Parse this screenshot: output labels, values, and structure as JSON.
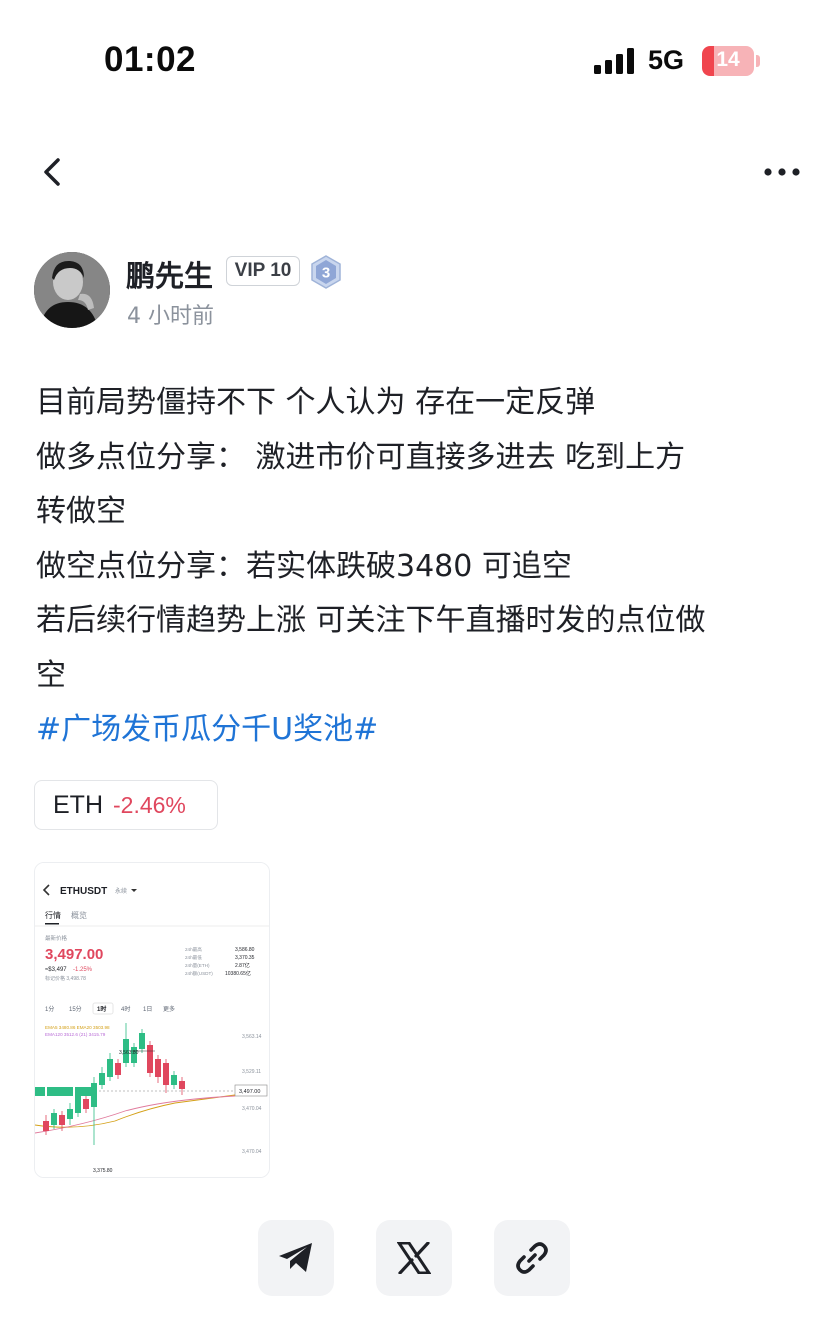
{
  "status_bar": {
    "time": "01:02",
    "network": "5G",
    "battery_level": "14",
    "battery_fraction": 0.14
  },
  "nav": {
    "back_icon": "chevron-left-icon",
    "more_icon": "ellipsis-icon"
  },
  "author": {
    "name": "鹏先生",
    "vip": "VIP 10",
    "level": "3",
    "time_ago": "4 小时前"
  },
  "post": {
    "lines": [
      "目前局势僵持不下 个人认为 存在一定反弹",
      "做多点位分享： 激进市价可直接多进去 吃到上方",
      "转做空",
      "做空点位分享：若实体跌破3480 可追空",
      "若后续行情趋势上涨 可关注下午直播时发的点位做",
      "空"
    ],
    "hashtag": "#广场发币瓜分千U奖池#"
  },
  "ticker": {
    "symbol": "ETH",
    "change": "-2.46%",
    "change_color": "#e0475e"
  },
  "image_thumb": {
    "pair": "ETHUSDT",
    "pair_suffix": "永续",
    "tabs": [
      "行情",
      "概览"
    ],
    "price_label": "最新价格",
    "price": "3,497.00",
    "price_sub": "≈$3,497",
    "price_change": "-1.25%",
    "mark_price": "标记价格 3,498.78",
    "stats_labels": [
      "24h最高",
      "24h最低",
      "24h量(ETH)",
      "24h额(USDT)"
    ],
    "stats_values": [
      "3,586.80",
      "3,370.35",
      "2.87亿",
      "10380.65亿"
    ],
    "timeframes": [
      "1分",
      "15分",
      "1时",
      "4时",
      "1日",
      "更多"
    ],
    "ema_line1": "EMA5 3480.86   EMA20 3503.98",
    "ema_line2": "EMA120 3512.6 (21) 3415.79",
    "axis_labels": [
      "3,563.14",
      "3,529.11",
      "3,497.00",
      "3,470.04"
    ],
    "high_marker": "3,563.80",
    "low_marker": "3,375.80",
    "current_box": "3,497.00"
  },
  "share": {
    "icons": [
      "telegram-icon",
      "x-logo-icon",
      "link-icon"
    ]
  },
  "colors": {
    "hashtag": "#1f74d6",
    "down": "#e0475e",
    "up": "#2ebd85"
  }
}
